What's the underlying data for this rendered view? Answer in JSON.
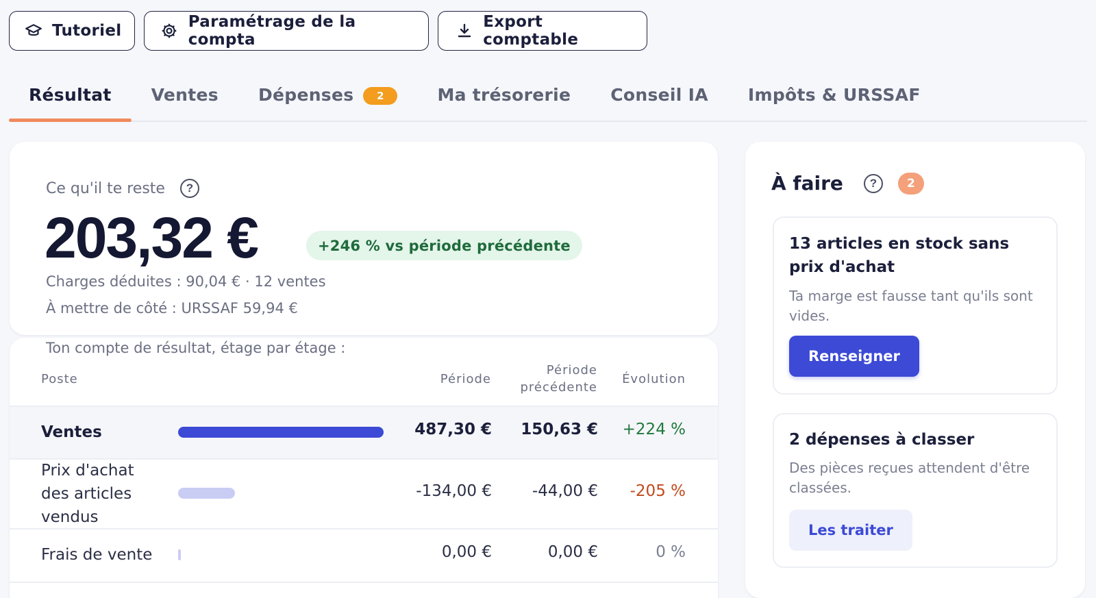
{
  "toolbar": {
    "tutorial_label": "Tutoriel",
    "settings_label": "Paramétrage de la compta",
    "export_label": "Export comptable"
  },
  "tabs": [
    {
      "label": "Résultat",
      "active": true
    },
    {
      "label": "Ventes"
    },
    {
      "label": "Dépenses",
      "badge": "2"
    },
    {
      "label": "Ma trésorerie"
    },
    {
      "label": "Conseil IA"
    },
    {
      "label": "Impôts & URSSAF"
    }
  ],
  "summary": {
    "label": "Ce qu'il te reste",
    "amount": "203,32 €",
    "delta": "+246 % vs période précédente",
    "charges": "Charges déduites : 90,04 € · 12 ventes",
    "set_aside": "À mettre de côté : URSSAF 59,94 €"
  },
  "income_statement": {
    "intro": "Ton compte de résultat, étage par étage :",
    "headers": {
      "poste": "Poste",
      "periode": "Période",
      "precedente_l1": "Période",
      "precedente_l2": "précédente",
      "evolution": "Évolution"
    },
    "rows": [
      {
        "name": "Ventes",
        "period": "487,30 €",
        "previous": "150,63 €",
        "evolution": "+224 %",
        "share": 1.0
      },
      {
        "name_l1": "Prix d'achat",
        "name_l2": "des articles",
        "name_l3": "vendus",
        "period": "-134,00 €",
        "previous": "-44,00 €",
        "evolution": "-205 %",
        "share": 0.275
      },
      {
        "name": "Frais de vente",
        "period": "0,00 €",
        "previous": "0,00 €",
        "evolution": "0 %",
        "share": 0.0
      }
    ]
  },
  "todo": {
    "title": "À faire",
    "count": "2",
    "tasks": [
      {
        "title": "13 articles en stock sans prix d'achat",
        "description": "Ta marge est fausse tant qu'ils sont vides.",
        "action": "Renseigner"
      },
      {
        "title": "2 dépenses à classer",
        "description": "Des pièces reçues attendent d'être classées.",
        "action": "Les traiter"
      }
    ]
  },
  "colors": {
    "accent": "#3c4ad6",
    "tab_underline": "#f08a5d",
    "badge_orange": "#f39c1e",
    "positive": "#1f7a3d",
    "negative": "#c2491d",
    "neutral": "#7a7f91"
  },
  "icons": {
    "tutorial": "graduation-cap-icon",
    "settings": "gear-icon",
    "export": "download-icon",
    "help": "question-circle-icon"
  }
}
